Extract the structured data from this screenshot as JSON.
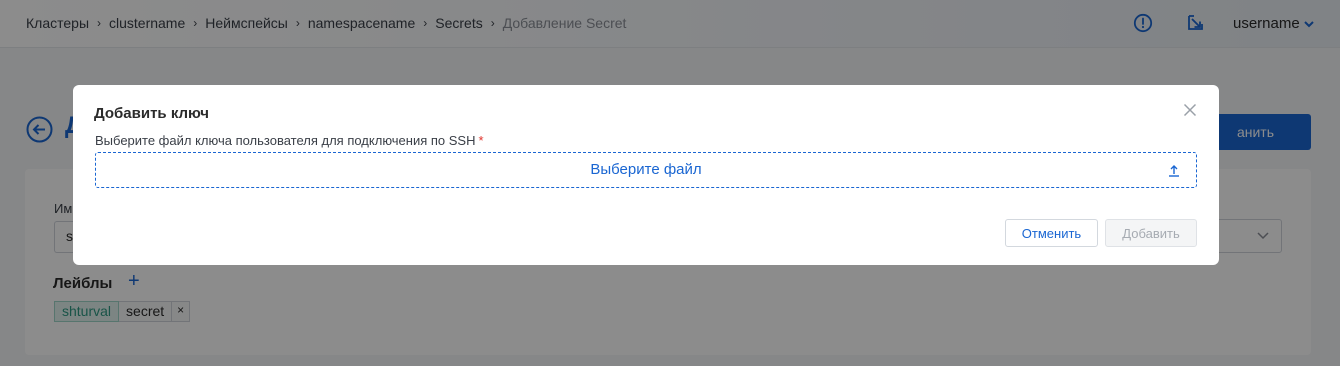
{
  "breadcrumb": {
    "items": [
      "Кластеры",
      "clustername",
      "Неймспейсы",
      "namespacename",
      "Secrets",
      "Добавление Secret"
    ],
    "separator": "›"
  },
  "header": {
    "icons": [
      "alert-circle-icon",
      "external-link-icon"
    ],
    "username": "username"
  },
  "page": {
    "title": "Д",
    "primary_button": "анить",
    "field_label": "Им",
    "field_value": "s",
    "labels_title": "Лейблы",
    "labels_add": "+",
    "tags": [
      {
        "key": "shturval",
        "value": "secret",
        "remove": "×"
      }
    ]
  },
  "modal": {
    "title": "Добавить ключ",
    "file_label": "Выберите файл ключа пользователя для подключения по SSH",
    "required_mark": "*",
    "dropzone_text": "Выберите файл",
    "cancel_label": "Отменить",
    "add_label": "Добавить"
  },
  "colors": {
    "accent": "#1a66d2",
    "required": "#e0342d",
    "tag_key_bg": "#e2f3ef",
    "tag_key_text": "#2e9a83",
    "overlay": "rgba(0,0,0,0.45)"
  }
}
